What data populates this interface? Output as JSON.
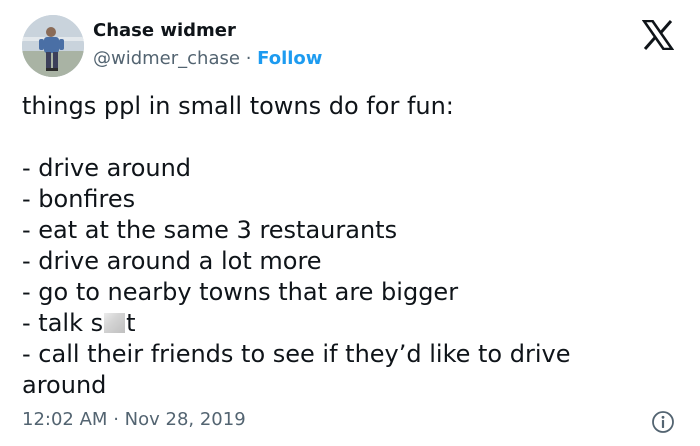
{
  "author": {
    "name": "Chase widmer",
    "handle": "@widmer_chase",
    "separator": "·",
    "follow_label": "Follow",
    "avatar_icon": "profile-photo"
  },
  "brand": {
    "logo_icon": "x-logo-icon"
  },
  "tweet": {
    "intro": "things ppl in small towns do for fun:",
    "lines": [
      "- drive around",
      "- bonfires",
      "- eat at the same 3 restaurants",
      "- drive around a lot more",
      "- go to nearby towns that are bigger"
    ],
    "censored_line": {
      "before": "- talk s",
      "after": "t"
    },
    "last_line_part1": "- call their friends to see if they’d like to drive",
    "last_line_part2": "around"
  },
  "meta": {
    "time": "12:02 AM",
    "separator": "·",
    "date": "Nov 28, 2019",
    "info_icon": "info-icon"
  },
  "colors": {
    "text": "#0f1419",
    "secondary": "#536471",
    "accent": "#1d9bf0",
    "background": "#ffffff"
  }
}
